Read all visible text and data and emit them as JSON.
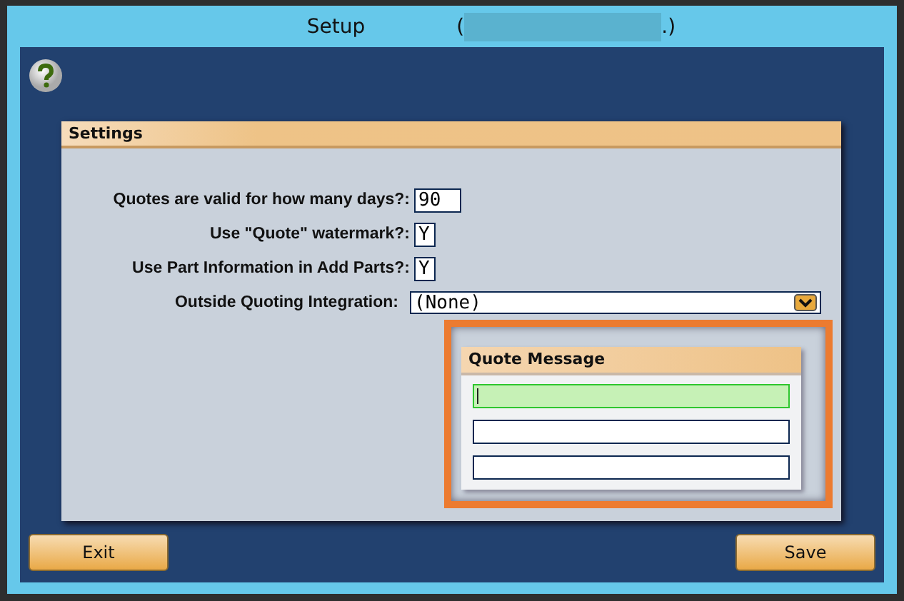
{
  "window": {
    "title": "Setup",
    "title_open": "(",
    "title_close": ".)",
    "redacted": true
  },
  "settings": {
    "title": "Settings",
    "rows": [
      {
        "kind": "text",
        "label": "Quotes are valid for how many days?:",
        "value": "90"
      },
      {
        "kind": "flag",
        "label": "Use \"Quote\" watermark?:",
        "value": "Y"
      },
      {
        "kind": "flag",
        "label": "Use Part Information in Add Parts?:",
        "value": "Y"
      },
      {
        "kind": "dropdown",
        "label": "Outside Quoting Integration:",
        "value": "(None)"
      }
    ]
  },
  "quote_message": {
    "title": "Quote Message",
    "highlighted": true,
    "lines": [
      {
        "focused": true
      },
      {
        "focused": false
      },
      {
        "focused": false
      }
    ]
  },
  "buttons": [
    {
      "label": "Exit"
    },
    {
      "label": "Save"
    }
  ]
}
